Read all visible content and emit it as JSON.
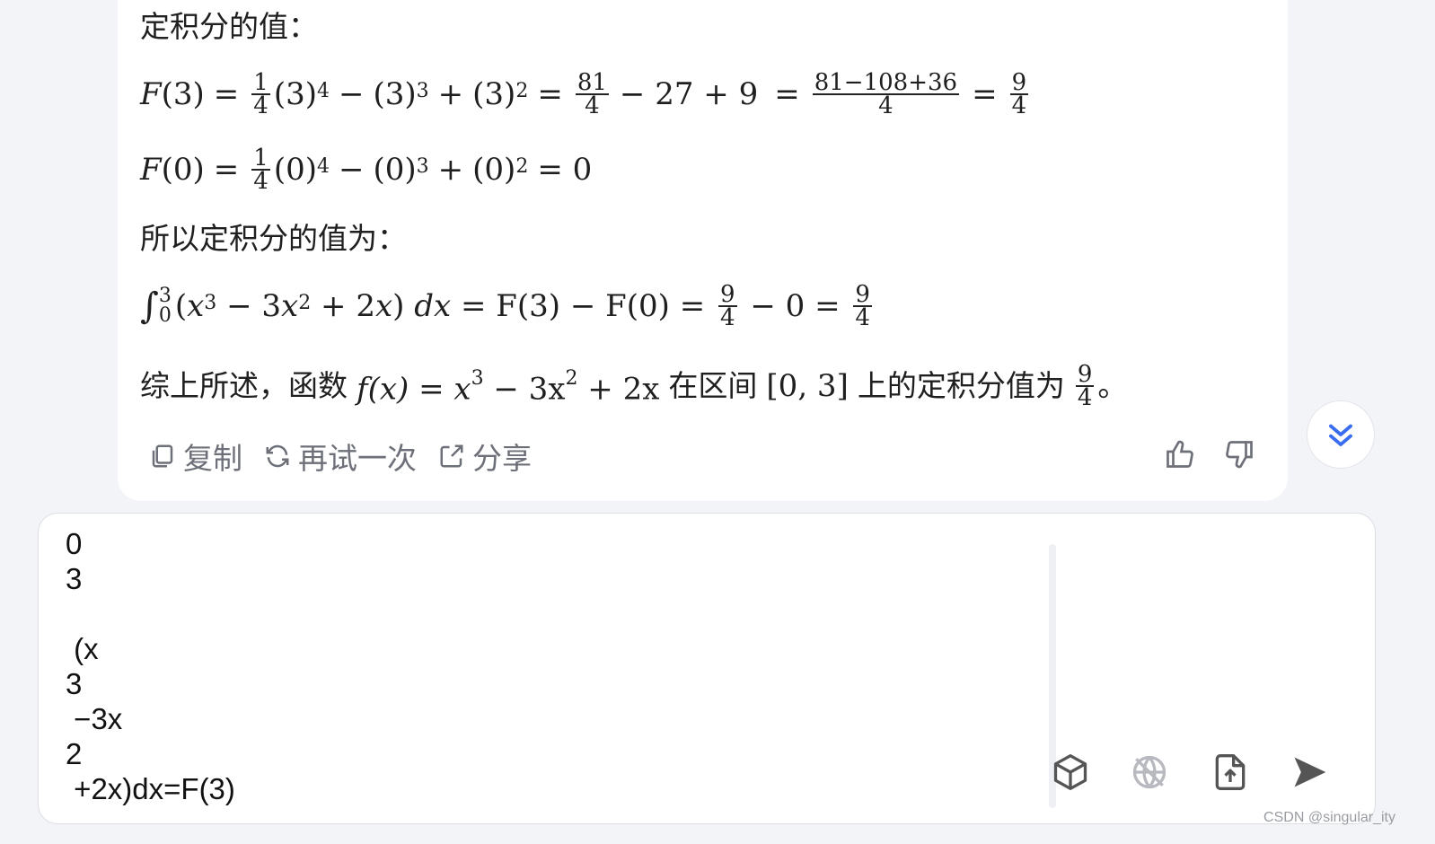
{
  "answer": {
    "heading_value": "定积分的值：",
    "f3": {
      "lhs": "F",
      "arg": "(3)",
      "eq": "=",
      "frac_one": {
        "num": "1",
        "den": "4"
      },
      "term1": "(3)",
      "exp4": "4",
      "minus": "−",
      "term2": "(3)",
      "exp3": "3",
      "plus": "+",
      "term3": "(3)",
      "exp2": "2",
      "frac_81": {
        "num": "81",
        "den": "4"
      },
      "rest": "− 27 + 9",
      "frac_combined": {
        "num": "81−108+36",
        "den": "4"
      },
      "frac_result": {
        "num": "9",
        "den": "4"
      }
    },
    "f0": {
      "lhs": "F",
      "arg": "(0)",
      "frac_one": {
        "num": "1",
        "den": "4"
      },
      "term1": "(0)",
      "exp4": "4",
      "term2": "(0)",
      "exp3": "3",
      "term3": "(0)",
      "exp2": "2",
      "result": "= 0"
    },
    "heading_result": "所以定积分的值为：",
    "integral": {
      "upper": "3",
      "lower": "0",
      "body_open": "(",
      "x": "x",
      "exp3": "3",
      "mid1": " − 3",
      "exp2": "2",
      "mid2": " + 2",
      "body_close": ") ",
      "dx": "dx",
      "eq_f": " = F(3) − F(0) = ",
      "frac1": {
        "num": "9",
        "den": "4"
      },
      "minus_zero": " − 0 = ",
      "frac2": {
        "num": "9",
        "den": "4"
      }
    },
    "summary": {
      "prefix": "综上所述，函数",
      "func": "f(x) = x",
      "exp3": "3",
      "mid": " − 3x",
      "exp2": "2",
      "tail": " + 2x",
      "middle_text": "在区间",
      "interval": "[0, 3]",
      "suffix": "上的定积分值为",
      "frac": {
        "num": "9",
        "den": "4"
      },
      "end": "。"
    },
    "actions": {
      "copy": "复制",
      "retry": "再试一次",
      "share": "分享"
    }
  },
  "input": {
    "text": "0\n3\n\n (x\n3\n −3x\n2\n +2x)dx=F(3)"
  },
  "tools": {
    "model_icon": "cube-icon",
    "web_icon": "globe-off-icon",
    "upload_icon": "file-upload-icon",
    "send_icon": "send-icon"
  },
  "watermark": "CSDN @singular_ity",
  "colors": {
    "accent": "#3a6df0",
    "muted": "#6e7079",
    "background": "#f3f4f7"
  }
}
